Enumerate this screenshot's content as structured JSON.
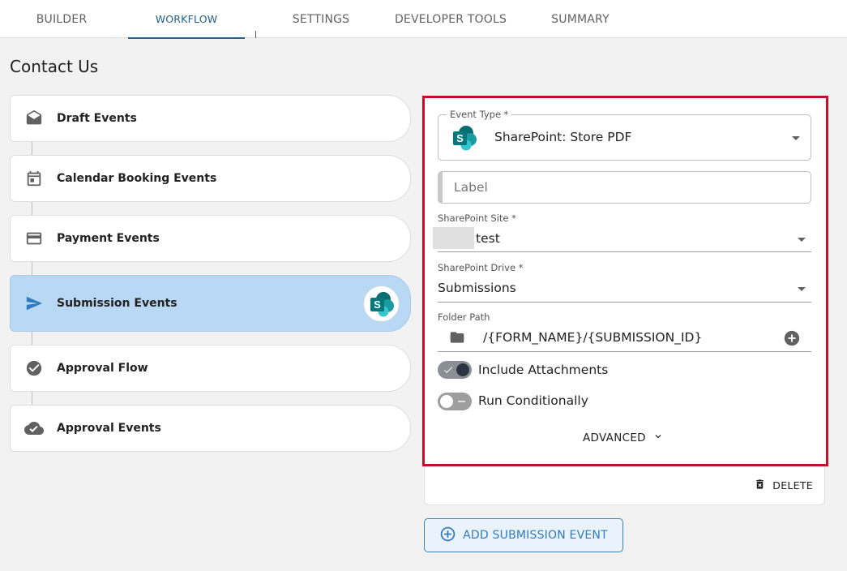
{
  "tabs": [
    {
      "label": "BUILDER"
    },
    {
      "label": "WORKFLOW"
    },
    {
      "label": "SETTINGS"
    },
    {
      "label": "DEVELOPER TOOLS"
    },
    {
      "label": "SUMMARY"
    }
  ],
  "page": {
    "title": "Contact Us"
  },
  "events": [
    {
      "label": "Draft Events",
      "icon": "envelope-open-icon"
    },
    {
      "label": "Calendar Booking Events",
      "icon": "calendar-icon"
    },
    {
      "label": "Payment Events",
      "icon": "credit-card-icon"
    },
    {
      "label": "Submission Events",
      "icon": "send-icon"
    },
    {
      "label": "Approval Flow",
      "icon": "check-circle-icon"
    },
    {
      "label": "Approval Events",
      "icon": "cloud-check-icon"
    }
  ],
  "form": {
    "event_type_label": "Event Type *",
    "event_type_value": "SharePoint: Store PDF",
    "label_placeholder": "Label",
    "site_label": "SharePoint Site *",
    "site_value": "test",
    "drive_label": "SharePoint Drive *",
    "drive_value": "Submissions",
    "folder_label": "Folder Path",
    "folder_value": "/{FORM_NAME}/{SUBMISSION_ID}",
    "include_attachments_label": "Include Attachments",
    "include_attachments_on": true,
    "run_conditionally_label": "Run Conditionally",
    "run_conditionally_on": false,
    "advanced_label": "ADVANCED"
  },
  "actions": {
    "delete_label": "DELETE",
    "add_label": "ADD SUBMISSION EVENT"
  },
  "colors": {
    "accent": "#1f5f8b",
    "highlight_border": "#c0102a",
    "selected_item": "#b9d8f4",
    "sharepoint": "#038387"
  }
}
